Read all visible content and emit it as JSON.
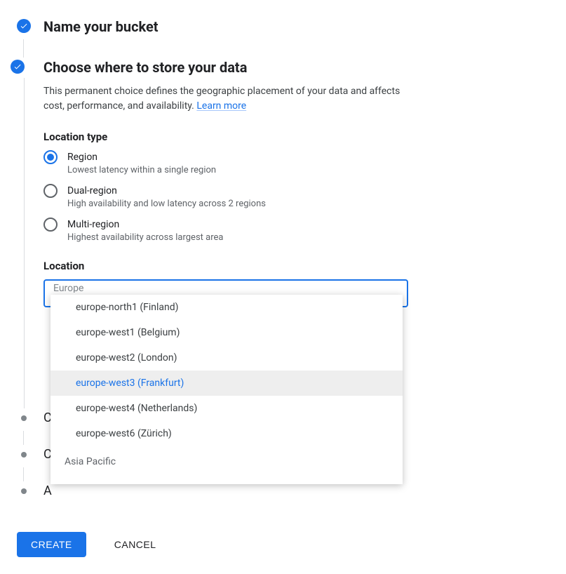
{
  "steps": {
    "name_bucket": {
      "title": "Name your bucket"
    },
    "choose_location": {
      "title": "Choose where to store your data",
      "description": "This permanent choice defines the geographic placement of your data and affects cost, performance, and availability.",
      "learn_more": "Learn more",
      "location_type_heading": "Location type",
      "options": {
        "region": {
          "label": "Region",
          "sub": "Lowest latency within a single region"
        },
        "dual": {
          "label": "Dual-region",
          "sub": "High availability and low latency across 2 regions"
        },
        "multi": {
          "label": "Multi-region",
          "sub": "Highest availability across largest area"
        }
      },
      "location_heading": "Location",
      "select_group_visible": "Europe",
      "dropdown": {
        "items": [
          "europe-north1 (Finland)",
          "europe-west1 (Belgium)",
          "europe-west2 (London)",
          "europe-west3 (Frankfurt)",
          "europe-west4 (Netherlands)",
          "europe-west6 (Zürich)"
        ],
        "next_group": "Asia Pacific"
      }
    },
    "collapsed": {
      "c1": "C",
      "c2": "C",
      "c3": "A"
    }
  },
  "buttons": {
    "create": "CREATE",
    "cancel": "CANCEL"
  }
}
